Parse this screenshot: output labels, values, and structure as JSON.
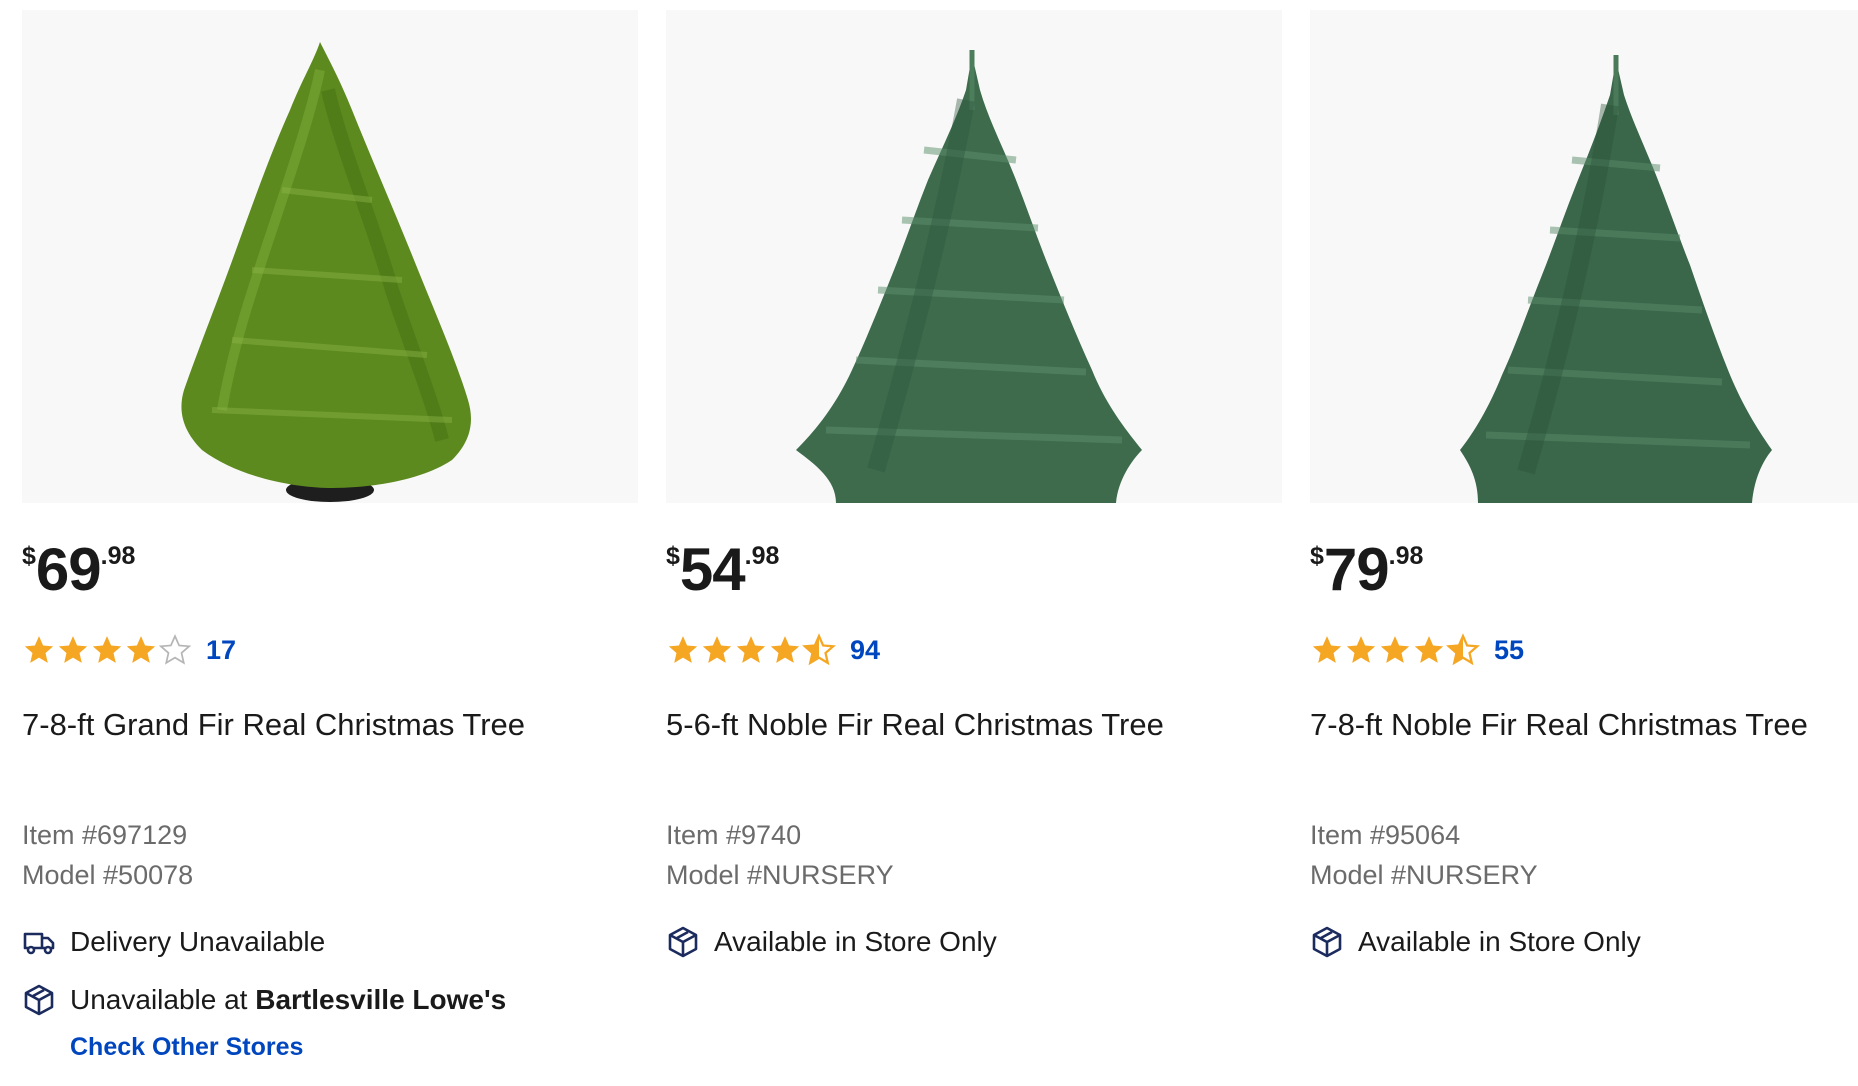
{
  "products": [
    {
      "image_alt": "7-8-ft Grand Fir Real Christmas Tree",
      "price": {
        "currency": "$",
        "dollars": "69",
        "cents": ".98"
      },
      "rating": {
        "stars": 4,
        "count": "17"
      },
      "title": "7-8-ft Grand Fir Real Christmas Tree",
      "item": "Item #697129",
      "model": "Model #50078",
      "availability": [
        {
          "icon": "truck-icon",
          "text": "Delivery Unavailable"
        },
        {
          "icon": "store-box-icon",
          "text": "Unavailable at ",
          "bold": "Bartlesville Lowe's"
        }
      ],
      "link": "Check Other Stores"
    },
    {
      "image_alt": "5-6-ft Noble Fir Real Christmas Tree",
      "price": {
        "currency": "$",
        "dollars": "54",
        "cents": ".98"
      },
      "rating": {
        "stars": 4.5,
        "count": "94"
      },
      "title": "5-6-ft Noble Fir Real Christmas Tree",
      "item": "Item #9740",
      "model": "Model #NURSERY",
      "availability": [
        {
          "icon": "store-box-icon",
          "text": "Available in Store Only"
        }
      ]
    },
    {
      "image_alt": "7-8-ft Noble Fir Real Christmas Tree",
      "price": {
        "currency": "$",
        "dollars": "79",
        "cents": ".98"
      },
      "rating": {
        "stars": 4.5,
        "count": "55"
      },
      "title": "7-8-ft Noble Fir Real Christmas Tree",
      "item": "Item #95064",
      "model": "Model #NURSERY",
      "availability": [
        {
          "icon": "store-box-icon",
          "text": "Available in Store Only"
        }
      ]
    }
  ],
  "colors": {
    "star": "#f5a623",
    "link": "#0046be",
    "icon": "#1b2b5e",
    "grand_fir": "#5c8a1e",
    "noble_fir": "#3d6b4c"
  }
}
